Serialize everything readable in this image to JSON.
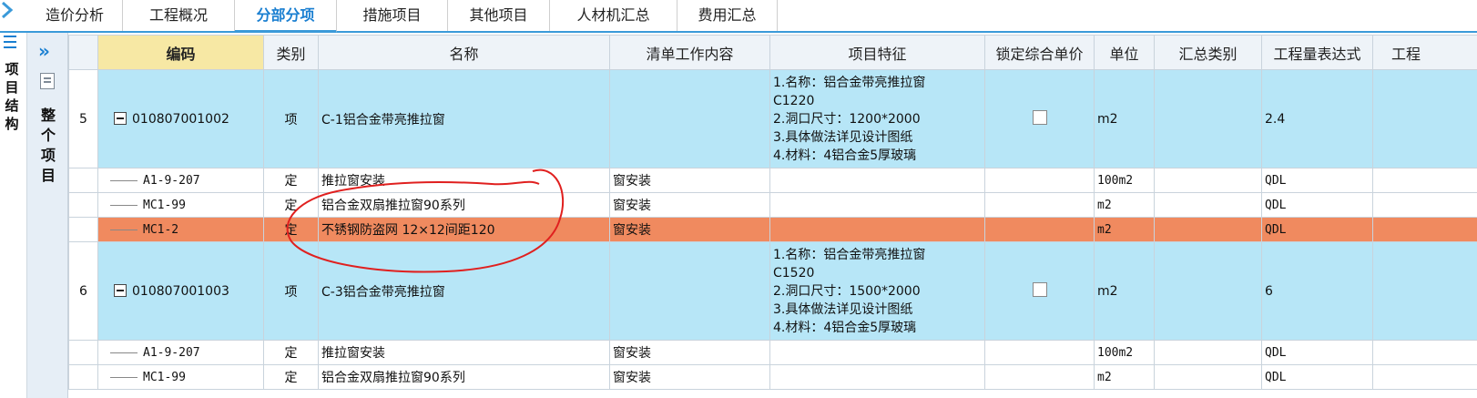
{
  "tabs": [
    {
      "label": "造价分析",
      "active": false
    },
    {
      "label": "工程概况",
      "active": false
    },
    {
      "label": "分部分项",
      "active": true
    },
    {
      "label": "措施项目",
      "active": false
    },
    {
      "label": "其他项目",
      "active": false
    },
    {
      "label": "人材机汇总",
      "active": false
    },
    {
      "label": "费用汇总",
      "active": false
    }
  ],
  "left_panel": {
    "vertical_label": "项目结构"
  },
  "side_panel": {
    "vertical_label": "整个项目"
  },
  "columns": [
    "编码",
    "类别",
    "名称",
    "清单工作内容",
    "项目特征",
    "锁定综合单价",
    "单位",
    "汇总类别",
    "工程量表达式",
    "工程"
  ],
  "rows": [
    {
      "type": "item",
      "num": "5",
      "code": "010807001002",
      "category": "项",
      "name": "C-1铝合金带亮推拉窗",
      "work": "",
      "features": [
        "1.名称：铝合金带亮推拉窗",
        "C1220",
        "2.洞口尺寸：1200*2000",
        "3.具体做法详见设计图纸",
        "4.材料：4铝合金5厚玻璃"
      ],
      "locked": false,
      "unit": "m2",
      "summary": "",
      "expr": "2.4"
    },
    {
      "type": "sub",
      "code": "A1-9-207",
      "category": "定",
      "name": "推拉窗安装",
      "work": "窗安装",
      "unit": "100m2",
      "expr": "QDL"
    },
    {
      "type": "sub",
      "code": "MC1-99",
      "category": "定",
      "name": "铝合金双扇推拉窗90系列",
      "work": "窗安装",
      "unit": "m2",
      "expr": "QDL"
    },
    {
      "type": "sub",
      "selected": true,
      "code": "MC1-2",
      "category": "定",
      "name": "不锈钢防盗网 12×12间距120",
      "work": "窗安装",
      "unit": "m2",
      "expr": "QDL"
    },
    {
      "type": "item",
      "num": "6",
      "code": "010807001003",
      "category": "项",
      "name": "C-3铝合金带亮推拉窗",
      "work": "",
      "features": [
        "1.名称：铝合金带亮推拉窗",
        "C1520",
        "2.洞口尺寸：1500*2000",
        "3.具体做法详见设计图纸",
        "4.材料：4铝合金5厚玻璃"
      ],
      "locked": false,
      "unit": "m2",
      "summary": "",
      "expr": "6"
    },
    {
      "type": "sub",
      "code": "A1-9-207",
      "category": "定",
      "name": "推拉窗安装",
      "work": "窗安装",
      "unit": "100m2",
      "expr": "QDL"
    },
    {
      "type": "sub",
      "code": "MC1-99",
      "category": "定",
      "name": "铝合金双扇推拉窗90系列",
      "work": "窗安装",
      "unit": "m2",
      "expr": "QDL"
    }
  ],
  "colors": {
    "item_row": "#b7e6f7",
    "selected_row": "#f08a5f",
    "accent": "#3a9ad9",
    "annotation": "#e0201f"
  }
}
